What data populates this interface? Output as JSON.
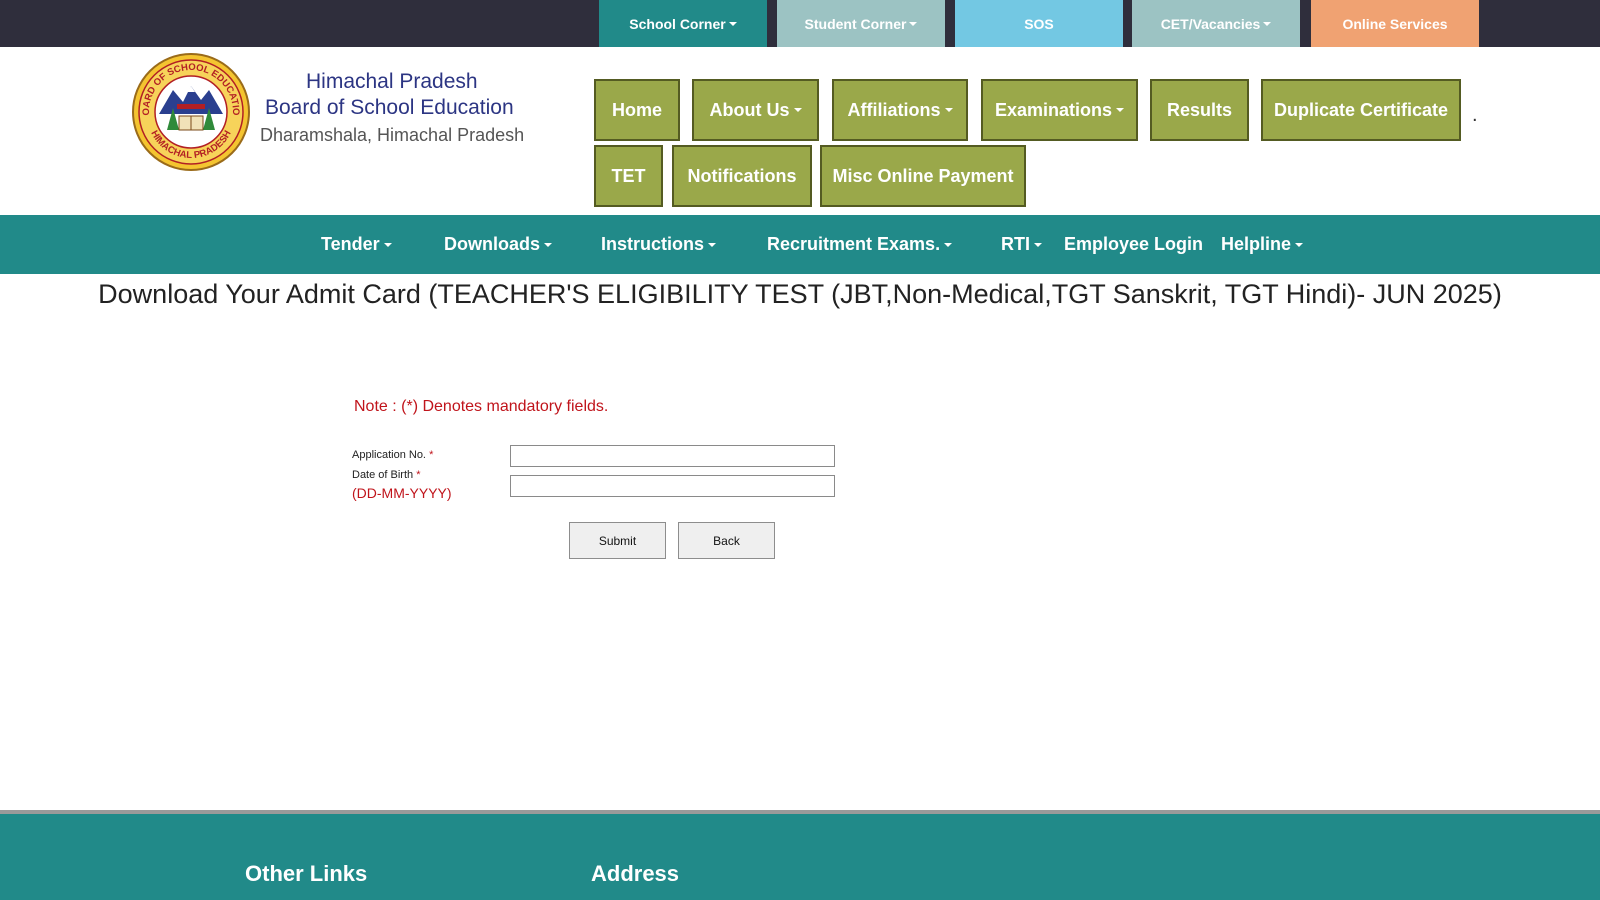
{
  "topbar": {
    "tabs": [
      {
        "label": "School Corner",
        "color": "#218a89",
        "dropdown": true
      },
      {
        "label": "Student Corner",
        "color": "#9cc3c3",
        "dropdown": true
      },
      {
        "label": "SOS",
        "color": "#73c8e3",
        "dropdown": false
      },
      {
        "label": "CET/Vacancies",
        "color": "#9cc3c3",
        "dropdown": true
      },
      {
        "label": "Online Services",
        "color": "#f0a272",
        "dropdown": false
      }
    ]
  },
  "header": {
    "brand": {
      "line1": "Himachal Pradesh",
      "line2": "Board of School Education",
      "line3": "Dharamshala, Himachal Pradesh"
    },
    "logo": {
      "text_top": "BOARD OF SCHOOL EDUCATION",
      "text_bottom": "HIMACHAL PRADESH"
    },
    "nav": [
      {
        "label": "Home"
      },
      {
        "label": "About Us",
        "dropdown": true
      },
      {
        "label": "Affiliations",
        "dropdown": true
      },
      {
        "label": "Examinations",
        "dropdown": true
      },
      {
        "label": "Results"
      },
      {
        "label": "Duplicate Certificate"
      },
      {
        "label": "TET"
      },
      {
        "label": "Notifications"
      },
      {
        "label": "Misc Online Payment"
      }
    ],
    "dot": "."
  },
  "mainnav": {
    "items": [
      {
        "label": "Tender",
        "dropdown": true
      },
      {
        "label": "Downloads",
        "dropdown": true
      },
      {
        "label": "Instructions",
        "dropdown": true
      },
      {
        "label": "Recruitment Exams.",
        "dropdown": true
      },
      {
        "label": "RTI",
        "dropdown": true
      },
      {
        "label": "Employee Login",
        "dropdown": false
      },
      {
        "label": "Helpline",
        "dropdown": true
      }
    ]
  },
  "page": {
    "title": "Download Your Admit Card (TEACHER'S ELIGIBILITY TEST (JBT,Non-Medical,TGT Sanskrit, TGT Hindi)- JUN 2025)"
  },
  "form": {
    "note": "Note  : (*) Denotes mandatory fields.",
    "application_label": "Application No.",
    "dob_label": "Date of Birth",
    "required_mark": "*",
    "dob_format": "(DD-MM-YYYY)",
    "application_value": "",
    "dob_value": "",
    "submit_label": "Submit",
    "back_label": "Back"
  },
  "footer": {
    "other_links": "Other Links",
    "address": "Address"
  },
  "colors": {
    "teal": "#218a89",
    "olive": "#9aa84a",
    "dark_bar": "#2f2e3c",
    "required_red": "#c0141b",
    "brand_blue": "#2c3583"
  }
}
